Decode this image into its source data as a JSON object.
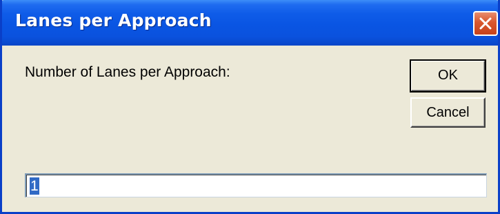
{
  "dialog": {
    "title": "Lanes per Approach",
    "prompt": "Number of Lanes per Approach:",
    "ok_label": "OK",
    "cancel_label": "Cancel",
    "input_value": "1",
    "close_icon": "close-icon"
  },
  "colors": {
    "titlebar": "#0A55E3",
    "window_bg": "#ECE9D8",
    "close_button": "#D9572E",
    "selection": "#316AC5"
  }
}
